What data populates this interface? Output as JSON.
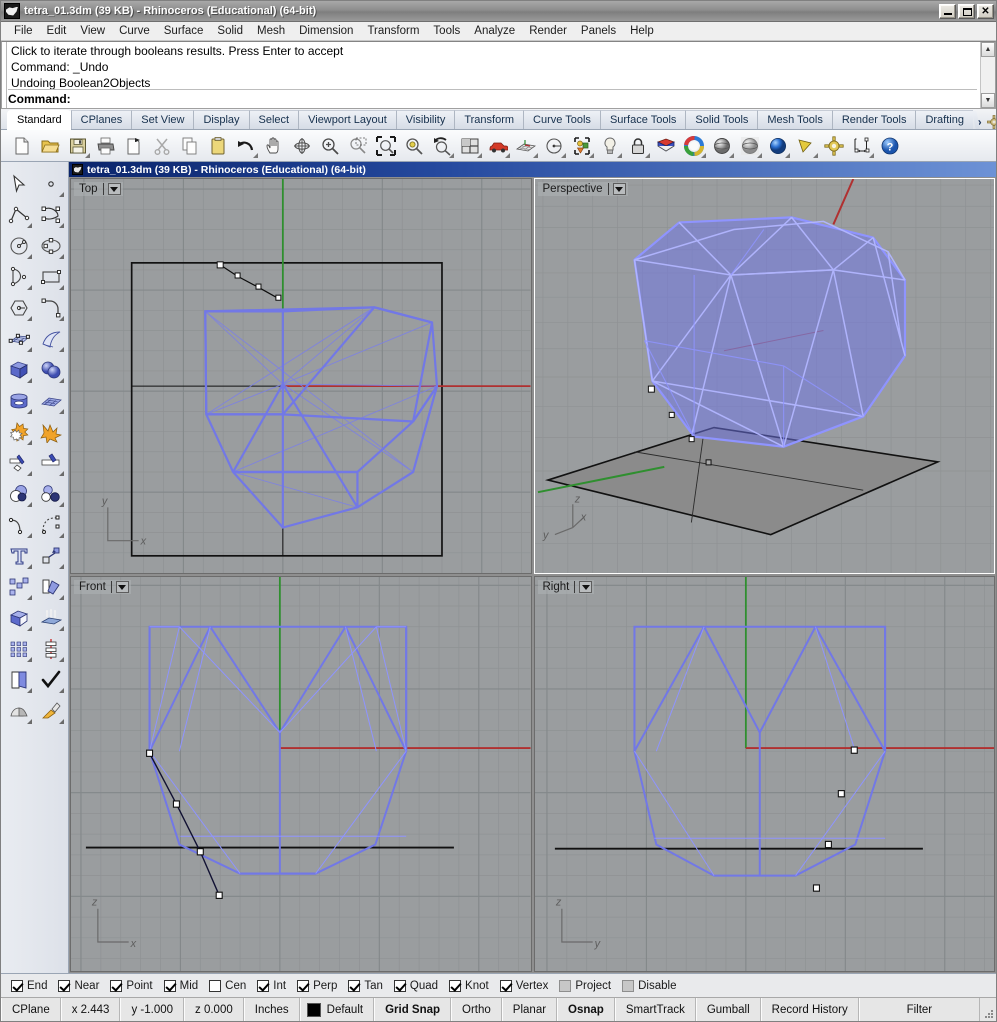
{
  "window": {
    "title": "tetra_01.3dm (39 KB) - Rhinoceros (Educational) (64-bit)",
    "minimize_label": "",
    "maximize_label": "",
    "close_label": "✕"
  },
  "menu": {
    "items": [
      "File",
      "Edit",
      "View",
      "Curve",
      "Surface",
      "Solid",
      "Mesh",
      "Dimension",
      "Transform",
      "Tools",
      "Analyze",
      "Render",
      "Panels",
      "Help"
    ]
  },
  "command_history": {
    "lines": [
      "Click to iterate through booleans results. Press Enter to accept",
      "Command: _Undo",
      "Undoing Boolean2Objects"
    ],
    "prompt": "Command:",
    "scroll_up": "▲",
    "scroll_down": "▼"
  },
  "toolbar_tabs": {
    "items": [
      "Standard",
      "CPlanes",
      "Set View",
      "Display",
      "Select",
      "Viewport Layout",
      "Visibility",
      "Transform",
      "Curve Tools",
      "Surface Tools",
      "Solid Tools",
      "Mesh Tools",
      "Render Tools",
      "Drafting"
    ],
    "active": "Standard",
    "overflow_label": "»"
  },
  "icon_toolbar": {
    "items": [
      {
        "name": "new-file-icon",
        "tooltip": "New"
      },
      {
        "name": "open-folder-icon",
        "tooltip": "Open"
      },
      {
        "name": "save-icon",
        "tooltip": "Save"
      },
      {
        "name": "print-icon",
        "tooltip": "Print"
      },
      {
        "name": "export-icon",
        "tooltip": "Export"
      },
      {
        "name": "cut-scissors-icon",
        "tooltip": "Cut"
      },
      {
        "name": "copy-icon",
        "tooltip": "Copy"
      },
      {
        "name": "paste-clipboard-icon",
        "tooltip": "Paste"
      },
      {
        "name": "undo-icon",
        "tooltip": "Undo"
      },
      {
        "name": "pan-hand-icon",
        "tooltip": "Pan"
      },
      {
        "name": "rotate-view-icon",
        "tooltip": "Rotate View"
      },
      {
        "name": "zoom-in-icon",
        "tooltip": "Zoom In"
      },
      {
        "name": "zoom-window-icon",
        "tooltip": "Zoom Window"
      },
      {
        "name": "zoom-extents-icon",
        "tooltip": "Zoom Extents"
      },
      {
        "name": "zoom-selected-icon",
        "tooltip": "Zoom Selected"
      },
      {
        "name": "zoom-previous-icon",
        "tooltip": "Zoom Previous"
      },
      {
        "name": "viewport-layout-icon",
        "tooltip": "4 Viewports"
      },
      {
        "name": "named-view-car-icon",
        "tooltip": "Named Views"
      },
      {
        "name": "cplane-grid-icon",
        "tooltip": "Set CPlane"
      },
      {
        "name": "named-cplane-icon",
        "tooltip": "Named CPlanes"
      },
      {
        "name": "select-objects-icon",
        "tooltip": "Select Objects"
      },
      {
        "name": "layer-light-bulb-icon",
        "tooltip": "Layers On/Off"
      },
      {
        "name": "lock-object-icon",
        "tooltip": "Lock"
      },
      {
        "name": "render-color-icon",
        "tooltip": "Render Color"
      },
      {
        "name": "color-wheel-icon",
        "tooltip": "Color Wheel"
      },
      {
        "name": "shaded-sphere-icon",
        "tooltip": "Shaded"
      },
      {
        "name": "ghosted-sphere-icon",
        "tooltip": "Ghosted"
      },
      {
        "name": "rendered-sphere-icon",
        "tooltip": "Rendered"
      },
      {
        "name": "render-preview-icon",
        "tooltip": "Render"
      },
      {
        "name": "render-settings-gear-icon",
        "tooltip": "Render Settings"
      },
      {
        "name": "dimension-icon",
        "tooltip": "Dimension"
      },
      {
        "name": "help-icon",
        "tooltip": "Help"
      }
    ]
  },
  "left_toolbar": {
    "rows": [
      [
        {
          "name": "select-arrow-icon"
        },
        {
          "name": "point-icon"
        }
      ],
      [
        {
          "name": "polyline-icon"
        },
        {
          "name": "control-point-curve-icon"
        }
      ],
      [
        {
          "name": "circle-icon"
        },
        {
          "name": "ellipse-icon"
        }
      ],
      [
        {
          "name": "arc-icon"
        },
        {
          "name": "rectangle-icon"
        }
      ],
      [
        {
          "name": "polygon-icon"
        },
        {
          "name": "fillet-curve-icon"
        }
      ],
      [
        {
          "name": "surface-control-points-icon"
        },
        {
          "name": "surface-sweep-icon"
        }
      ],
      [
        {
          "name": "box-solid-icon"
        },
        {
          "name": "sphere-boolean-icon"
        }
      ],
      [
        {
          "name": "cylinder-icon"
        },
        {
          "name": "mesh-plane-icon"
        }
      ],
      [
        {
          "name": "boolean-union-icon"
        },
        {
          "name": "explode-icon"
        }
      ],
      [
        {
          "name": "trim-icon"
        },
        {
          "name": "split-icon"
        }
      ],
      [
        {
          "name": "boolean-difference-icon"
        },
        {
          "name": "boolean-intersection-icon"
        }
      ],
      [
        {
          "name": "offset-curve-icon"
        },
        {
          "name": "curve-from-object-icon"
        }
      ],
      [
        {
          "name": "text-tool-icon"
        },
        {
          "name": "scale-icon"
        }
      ],
      [
        {
          "name": "array-icon"
        },
        {
          "name": "copy-move-icon"
        }
      ],
      [
        {
          "name": "extrude-solid-icon"
        },
        {
          "name": "extrude-surface-icon"
        }
      ],
      [
        {
          "name": "grid-array-icon"
        },
        {
          "name": "analyze-direction-icon"
        }
      ],
      [
        {
          "name": "page-layout-icon"
        },
        {
          "name": "check-object-icon"
        }
      ],
      [
        {
          "name": "render-mesh-icon"
        },
        {
          "name": "render-paint-icon"
        }
      ]
    ]
  },
  "inner_window": {
    "title": "tetra_01.3dm (39 KB) - Rhinoceros (Educational) (64-bit)"
  },
  "viewports": [
    {
      "name": "viewport-top",
      "label": "Top",
      "active": false
    },
    {
      "name": "viewport-perspective",
      "label": "Perspective",
      "active": true
    },
    {
      "name": "viewport-front",
      "label": "Front",
      "active": false
    },
    {
      "name": "viewport-right",
      "label": "Right",
      "active": false
    }
  ],
  "osnap": {
    "items": [
      {
        "label": "End",
        "checked": true,
        "disabled": false
      },
      {
        "label": "Near",
        "checked": true,
        "disabled": false
      },
      {
        "label": "Point",
        "checked": true,
        "disabled": false
      },
      {
        "label": "Mid",
        "checked": true,
        "disabled": false
      },
      {
        "label": "Cen",
        "checked": false,
        "disabled": false
      },
      {
        "label": "Int",
        "checked": true,
        "disabled": false
      },
      {
        "label": "Perp",
        "checked": true,
        "disabled": false
      },
      {
        "label": "Tan",
        "checked": true,
        "disabled": false
      },
      {
        "label": "Quad",
        "checked": true,
        "disabled": false
      },
      {
        "label": "Knot",
        "checked": true,
        "disabled": false
      },
      {
        "label": "Vertex",
        "checked": true,
        "disabled": false
      },
      {
        "label": "Project",
        "checked": false,
        "disabled": true
      },
      {
        "label": "Disable",
        "checked": false,
        "disabled": true
      }
    ]
  },
  "status_bar": {
    "cplane_label": "CPlane",
    "x_value": "x 2.443",
    "y_value": "y -1.000",
    "z_value": "z 0.000",
    "units": "Inches",
    "layer_name": "Default",
    "layer_color": "#000000",
    "toggles": [
      {
        "label": "Grid Snap",
        "active": true
      },
      {
        "label": "Ortho",
        "active": false
      },
      {
        "label": "Planar",
        "active": false
      },
      {
        "label": "Osnap",
        "active": true
      },
      {
        "label": "SmartTrack",
        "active": false
      },
      {
        "label": "Gumball",
        "active": false
      },
      {
        "label": "Record History",
        "active": false
      },
      {
        "label": "Filter",
        "active": false
      }
    ]
  },
  "colors": {
    "accent_blue": "#7b7fe8",
    "selected_object": "#6f74e6",
    "viewport_bg": "#9a9d9f",
    "grid_line": "#8c8f91",
    "x_axis": "#b03030",
    "y_axis": "#2f8f2f",
    "title_blue": "#25499e"
  }
}
